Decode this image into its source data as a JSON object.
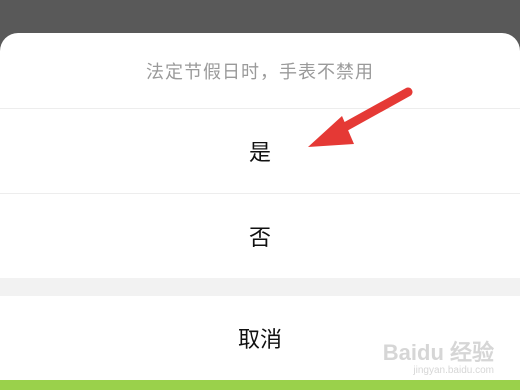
{
  "sheet": {
    "title": "法定节假日时，手表不禁用",
    "options": [
      "是",
      "否"
    ],
    "cancel_label": "取消"
  },
  "annotation": {
    "arrow_color": "#e53935",
    "points_to": "是"
  },
  "watermark": {
    "brand": "Baidu 经验",
    "url": "jingyan.baidu.com"
  },
  "colors": {
    "overlay": "#595959",
    "sheet_bg": "#ffffff",
    "title_text": "#9a9a9a",
    "option_text": "#111111",
    "separator_gap": "#f2f2f2",
    "bottom_bar": "#9ad14b"
  }
}
